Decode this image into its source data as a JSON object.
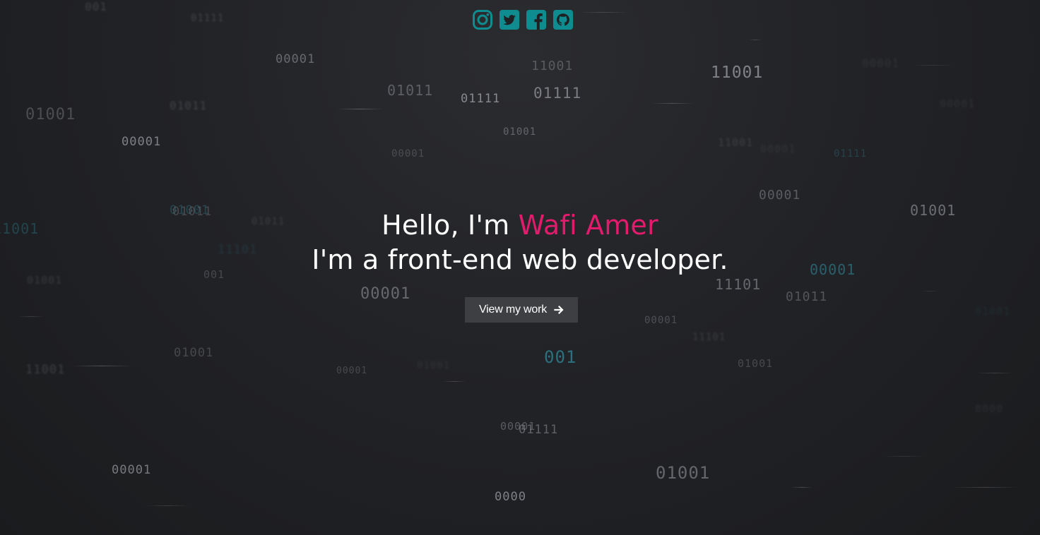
{
  "colors": {
    "accent": "#e31b6d",
    "icon": "#0f8c8f",
    "button_bg": "#3e3f42",
    "text": "#ffffff"
  },
  "social": [
    {
      "name": "instagram-icon"
    },
    {
      "name": "twitter-icon"
    },
    {
      "name": "facebook-icon"
    },
    {
      "name": "github-icon"
    }
  ],
  "hero": {
    "greeting": "Hello, I'm ",
    "name": "Wafi Amer",
    "tagline": "I'm a front-end web developer."
  },
  "cta": {
    "label": "View my work"
  },
  "background_binary": [
    "01001",
    "0000",
    "00001",
    "001",
    "00001",
    "01111",
    "11001",
    "01011",
    "01111",
    "11001",
    "00001",
    "01001",
    "11101",
    "01011",
    "00001",
    "01001",
    "01111",
    "01001",
    "01001",
    "11001",
    "01001",
    "00001",
    "00001",
    "01011",
    "11101",
    "00001",
    "001",
    "01001",
    "11001",
    "00001",
    "01011",
    "01111",
    "01001",
    "11101",
    "00001",
    "00001",
    "00001",
    "0000",
    "01001",
    "001",
    "01111",
    "01011",
    "00001",
    "01001",
    "00001",
    "11001"
  ]
}
